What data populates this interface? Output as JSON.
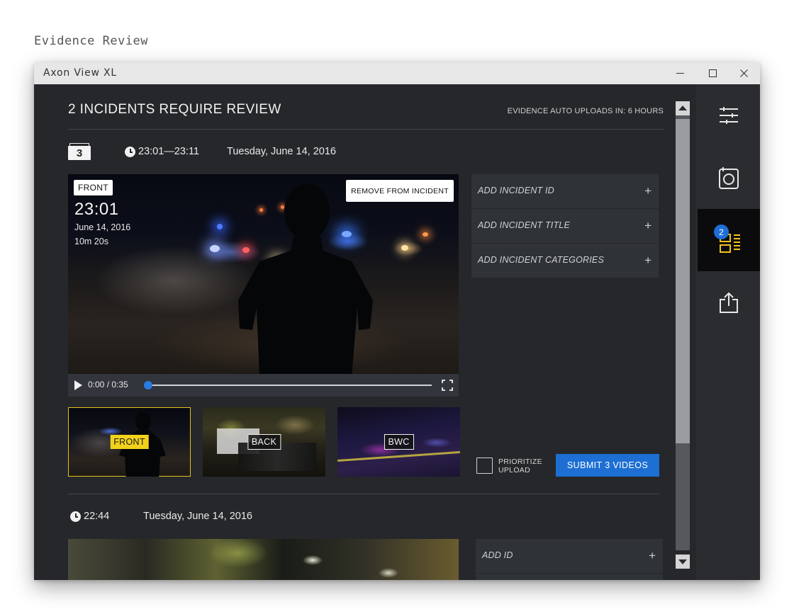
{
  "page_heading": "Evidence Review",
  "window": {
    "title": "Axon View XL"
  },
  "header": {
    "title": "2 INCIDENTS REQUIRE REVIEW",
    "upload_note": "EVIDENCE AUTO UPLOADS IN: 6 HOURS"
  },
  "incident1": {
    "video_count": "3",
    "time_range": "23:01—23:11",
    "date": "Tuesday, June 14, 2016",
    "player": {
      "camera_label": "FRONT",
      "remove_label": "REMOVE FROM INCIDENT",
      "overlay_time": "23:01",
      "overlay_date": "June 14, 2016",
      "overlay_duration": "10m 20s",
      "time_display": "0:00 / 0:35",
      "progress": 0
    },
    "thumbnails": [
      {
        "label": "FRONT",
        "selected": true
      },
      {
        "label": "BACK",
        "selected": false
      },
      {
        "label": "BWC",
        "selected": false
      }
    ],
    "fields": [
      {
        "label": "ADD INCIDENT ID",
        "icon": "+"
      },
      {
        "label": "ADD INCIDENT  TITLE",
        "icon": "+"
      },
      {
        "label": "ADD INCIDENT CATEGORIES",
        "icon": "+"
      }
    ],
    "prioritize_line1": "PRIORITIZE",
    "prioritize_line2": "UPLOAD",
    "submit_label": "SUBMIT 3 VIDEOS"
  },
  "incident2": {
    "time": "22:44",
    "date": "Tuesday, June 14, 2016",
    "fields": [
      {
        "label": "ADD ID",
        "icon": "+"
      }
    ]
  },
  "sidebar": {
    "items": [
      {
        "icon": "sliders-icon"
      },
      {
        "icon": "camera-icon"
      },
      {
        "icon": "incidents-list-icon",
        "badge": "2",
        "active": true
      },
      {
        "icon": "share-upload-icon"
      }
    ]
  },
  "colors": {
    "accent_blue": "#1e6fd4",
    "highlight_yellow": "#f2d11c",
    "panel_bg": "#25272b"
  }
}
